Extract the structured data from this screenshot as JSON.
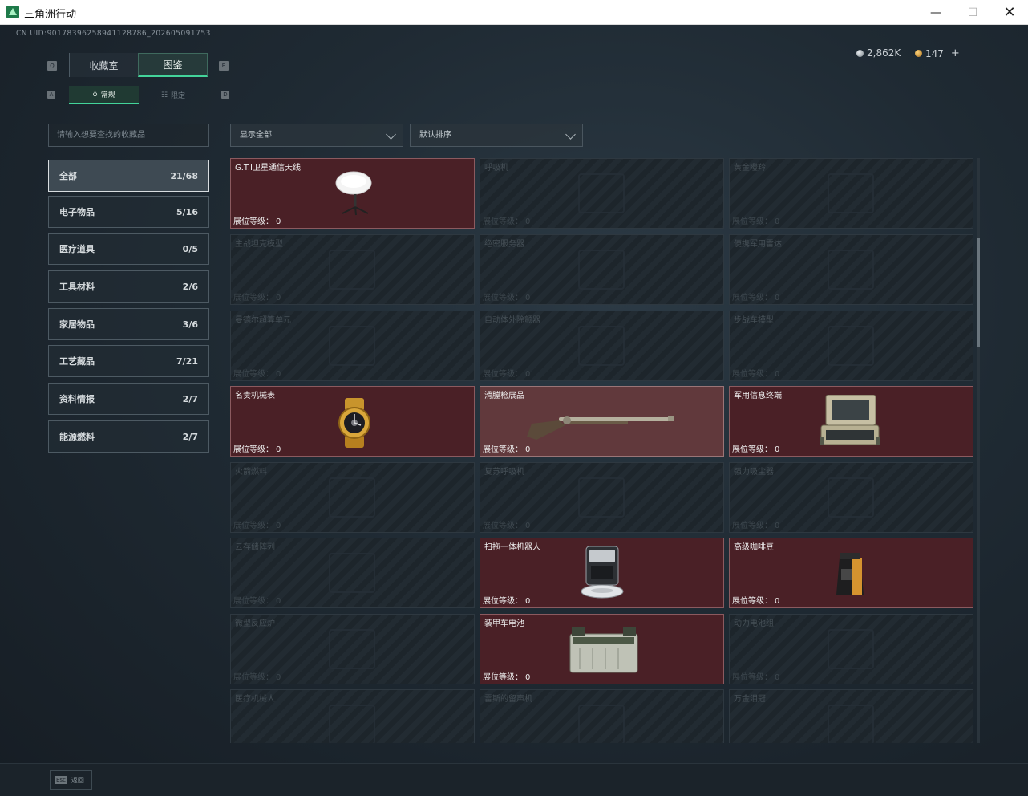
{
  "window": {
    "title": "三角洲行动",
    "minimize": "—",
    "maximize": "☐",
    "close": "✕"
  },
  "uid": "CN UID:9017839625894112878​6_202605091753",
  "currency": {
    "silver": "2,862K",
    "gold": "147",
    "plus": "+"
  },
  "tabs": {
    "collection": "收藏室",
    "atlas": "图鉴",
    "key_left": "Q",
    "key_right": "E"
  },
  "subtabs": {
    "regular": "常规",
    "limited": "限定",
    "key_left": "A",
    "key_right": "D"
  },
  "search": {
    "placeholder": "请输入想要查找的收藏品"
  },
  "filters": {
    "show": "显示全部",
    "sort": "默认排序"
  },
  "categories": [
    {
      "label": "全部",
      "count": "21/68",
      "active": true
    },
    {
      "label": "电子物品",
      "count": "5/16"
    },
    {
      "label": "医疗道具",
      "count": "0/5"
    },
    {
      "label": "工具材料",
      "count": "2/6"
    },
    {
      "label": "家居物品",
      "count": "3/6"
    },
    {
      "label": "工艺藏品",
      "count": "7/21"
    },
    {
      "label": "资料情报",
      "count": "2/7"
    },
    {
      "label": "能源燃料",
      "count": "2/7"
    }
  ],
  "level_label": "展位等级：",
  "items": [
    {
      "name": "G.T.I卫星通信天线",
      "level": "0",
      "owned": true,
      "icon": "satellite-dish"
    },
    {
      "name": "呼吸机",
      "level": "0",
      "owned": false
    },
    {
      "name": "黄金瞪羚",
      "level": "0",
      "owned": false
    },
    {
      "name": "主战坦克模型",
      "level": "0",
      "owned": false
    },
    {
      "name": "绝密服务器",
      "level": "0",
      "owned": false
    },
    {
      "name": "便携军用雷达",
      "level": "0",
      "owned": false
    },
    {
      "name": "曼德尔超算单元",
      "level": "0",
      "owned": false
    },
    {
      "name": "自动体外除颤器",
      "level": "0",
      "owned": false
    },
    {
      "name": "步战车模型",
      "level": "0",
      "owned": false
    },
    {
      "name": "名贵机械表",
      "level": "0",
      "owned": true,
      "icon": "gold-watch"
    },
    {
      "name": "滑膛枪展品",
      "level": "0",
      "owned": true,
      "icon": "musket"
    },
    {
      "name": "军用信息终端",
      "level": "0",
      "owned": true,
      "icon": "military-terminal"
    },
    {
      "name": "火箭燃料",
      "level": "0",
      "owned": false
    },
    {
      "name": "复苏呼吸机",
      "level": "0",
      "owned": false
    },
    {
      "name": "强力吸尘器",
      "level": "0",
      "owned": false
    },
    {
      "name": "云存储阵列",
      "level": "0",
      "owned": false
    },
    {
      "name": "扫拖一体机器人",
      "level": "0",
      "owned": true,
      "icon": "robot-vacuum"
    },
    {
      "name": "高级咖啡豆",
      "level": "0",
      "owned": true,
      "icon": "coffee-bag"
    },
    {
      "name": "微型反应炉",
      "level": "0",
      "owned": false
    },
    {
      "name": "装甲车电池",
      "level": "0",
      "owned": true,
      "icon": "armored-battery"
    },
    {
      "name": "动力电池组",
      "level": "0",
      "owned": false
    },
    {
      "name": "医疗机械人",
      "level": "",
      "owned": false
    },
    {
      "name": "雷斯的留声机",
      "level": "",
      "owned": false
    },
    {
      "name": "万金泪冠",
      "level": "",
      "owned": false
    }
  ],
  "bottom": {
    "esc_key": "Esc",
    "esc_label": "返回"
  },
  "colors": {
    "accent": "#43d49a",
    "owned_bg": "#4a2026",
    "background": "#1d262f"
  }
}
